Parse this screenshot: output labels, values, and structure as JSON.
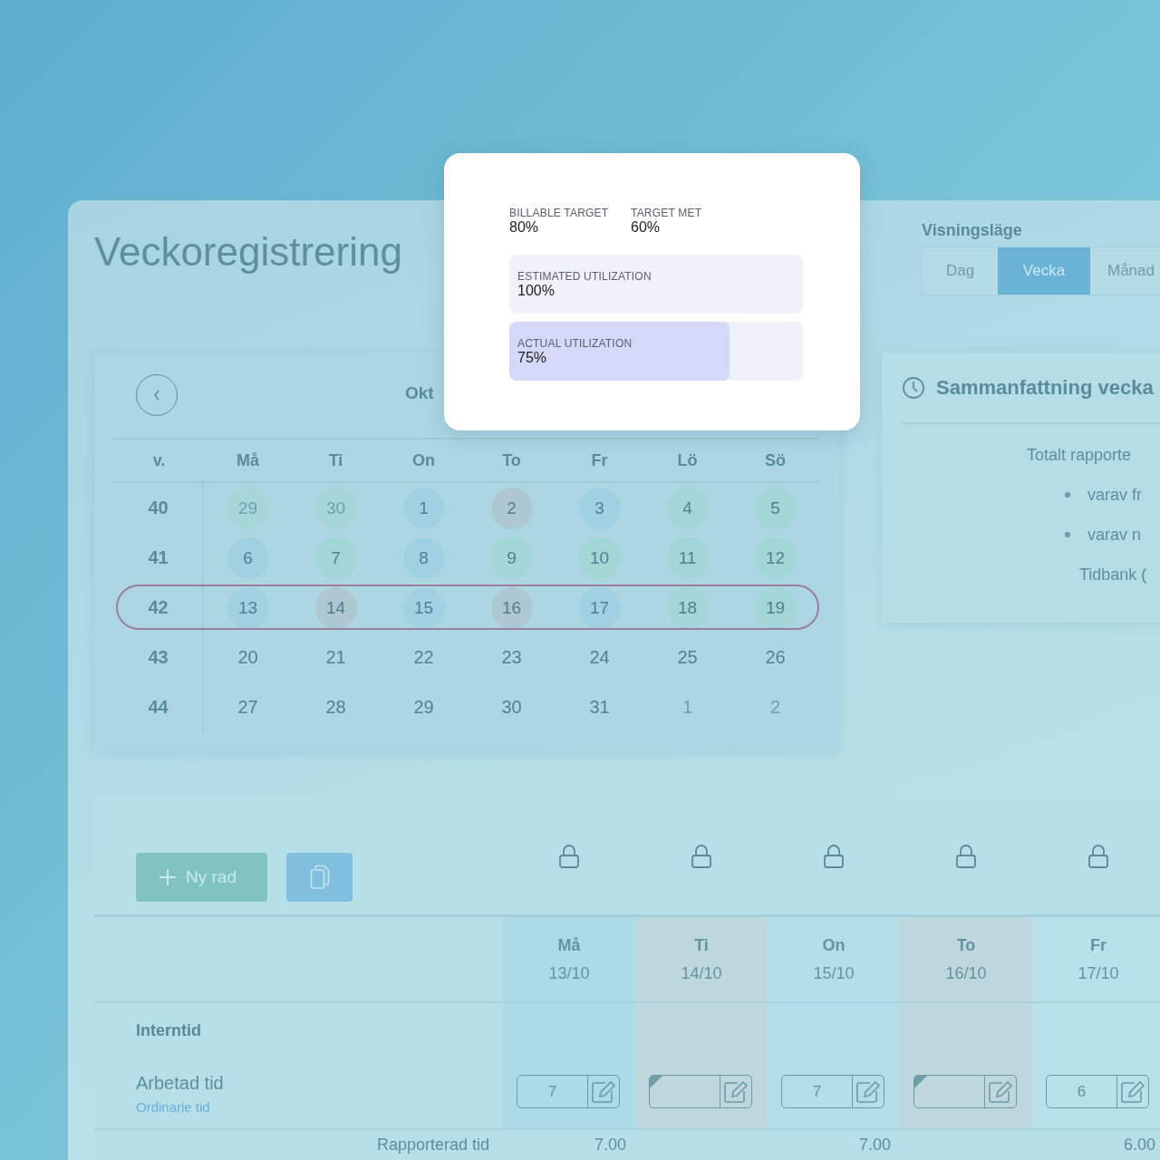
{
  "title": "Veckoregistrering",
  "view_mode": {
    "label": "Visningsläge",
    "options": [
      {
        "label": "Dag",
        "selected": false
      },
      {
        "label": "Vecka",
        "selected": true
      },
      {
        "label": "Månad",
        "selected": false
      }
    ]
  },
  "calendar": {
    "month": "Okt",
    "week_header": "v.",
    "weekdays": [
      "Må",
      "Ti",
      "On",
      "To",
      "Fr",
      "Lö",
      "Sö"
    ],
    "weeks": [
      {
        "number": "40",
        "selected": false,
        "days": [
          {
            "label": "29",
            "color": "#a6d6d8",
            "other_month": true
          },
          {
            "label": "30",
            "color": "#a6d6d8",
            "other_month": true
          },
          {
            "label": "1",
            "color": "#9fd1e3",
            "other_month": false
          },
          {
            "label": "2",
            "color": "#aec8d2",
            "other_month": false
          },
          {
            "label": "3",
            "color": "#9fd1e3",
            "other_month": false
          },
          {
            "label": "4",
            "color": "#a3d6d6",
            "other_month": false
          },
          {
            "label": "5",
            "color": "#a3d6d6",
            "other_month": false
          }
        ]
      },
      {
        "number": "41",
        "selected": false,
        "days": [
          {
            "label": "6",
            "color": "#9fd1e3",
            "other_month": false
          },
          {
            "label": "7",
            "color": "#a3d6d6",
            "other_month": false
          },
          {
            "label": "8",
            "color": "#9fd1e3",
            "other_month": false
          },
          {
            "label": "9",
            "color": "#a3d6d6",
            "other_month": false
          },
          {
            "label": "10",
            "color": "#a3d6d6",
            "other_month": false
          },
          {
            "label": "11",
            "color": "#a3d6d6",
            "other_month": false
          },
          {
            "label": "12",
            "color": "#a3d6d6",
            "other_month": false
          }
        ]
      },
      {
        "number": "42",
        "selected": true,
        "days": [
          {
            "label": "13",
            "color": "#9fd1e3",
            "other_month": false
          },
          {
            "label": "14",
            "color": "#aec8d2",
            "other_month": false
          },
          {
            "label": "15",
            "color": "#9fd1e3",
            "other_month": false
          },
          {
            "label": "16",
            "color": "#aec8d2",
            "other_month": false
          },
          {
            "label": "17",
            "color": "#9fd1e3",
            "other_month": false
          },
          {
            "label": "18",
            "color": "#a3d6d6",
            "other_month": false
          },
          {
            "label": "19",
            "color": "#a3d6d6",
            "other_month": false
          }
        ]
      },
      {
        "number": "43",
        "selected": false,
        "days": [
          {
            "label": "20",
            "other_month": false
          },
          {
            "label": "21",
            "other_month": false
          },
          {
            "label": "22",
            "other_month": false
          },
          {
            "label": "23",
            "other_month": false
          },
          {
            "label": "24",
            "other_month": false
          },
          {
            "label": "25",
            "other_month": false
          },
          {
            "label": "26",
            "other_month": false
          }
        ]
      },
      {
        "number": "44",
        "selected": false,
        "days": [
          {
            "label": "27",
            "other_month": false
          },
          {
            "label": "28",
            "other_month": false
          },
          {
            "label": "29",
            "other_month": false
          },
          {
            "label": "30",
            "other_month": false
          },
          {
            "label": "31",
            "other_month": false
          },
          {
            "label": "1",
            "other_month": true
          },
          {
            "label": "2",
            "other_month": true
          }
        ]
      }
    ]
  },
  "utilization": {
    "targets": [
      {
        "label": "BILLABLE TARGET",
        "value": "80%"
      },
      {
        "label": "TARGET MET",
        "value": "60%"
      }
    ],
    "bars": [
      {
        "label": "ESTIMATED UTILIZATION",
        "value": "100%",
        "kind": "box"
      },
      {
        "label": "ACTUAL UTILIZATION",
        "value": "75%",
        "kind": "bar",
        "level": 0.75
      }
    ]
  },
  "summary": {
    "title": "Sammanfattning vecka",
    "items": [
      {
        "kind": "total",
        "label": "Totalt rapporte"
      },
      {
        "kind": "bullet",
        "label": "varav fr"
      },
      {
        "kind": "bullet",
        "label": "varav n"
      },
      {
        "kind": "bank",
        "label": "Tidbank ("
      }
    ]
  },
  "timesheet": {
    "new_row_button": "Ny rad",
    "rows": [
      {
        "kind": "group",
        "label": "Interntid"
      },
      {
        "kind": "entry",
        "label": "Arbetad tid",
        "sublabel": "Ordinarie tid"
      }
    ],
    "total_label": "Rapporterad tid",
    "columns": [
      {
        "day": "Må",
        "date": "13/10",
        "color": "#acdae7",
        "entry": {
          "value": "7",
          "flagged": false
        },
        "total": "7.00"
      },
      {
        "day": "Ti",
        "date": "14/10",
        "color": "#bdd7dd",
        "entry": {
          "flagged": true
        }
      },
      {
        "day": "On",
        "date": "15/10",
        "color": "#b2dfe7",
        "entry": {
          "value": "7",
          "flagged": false
        },
        "total": "7.00"
      },
      {
        "day": "To",
        "date": "16/10",
        "color": "#bdd7dd",
        "entry": {
          "flagged": true
        }
      },
      {
        "day": "Fr",
        "date": "17/10",
        "color": "#b8e2e9",
        "entry": {
          "value": "6",
          "flagged": false
        },
        "total": "6.00"
      }
    ]
  }
}
